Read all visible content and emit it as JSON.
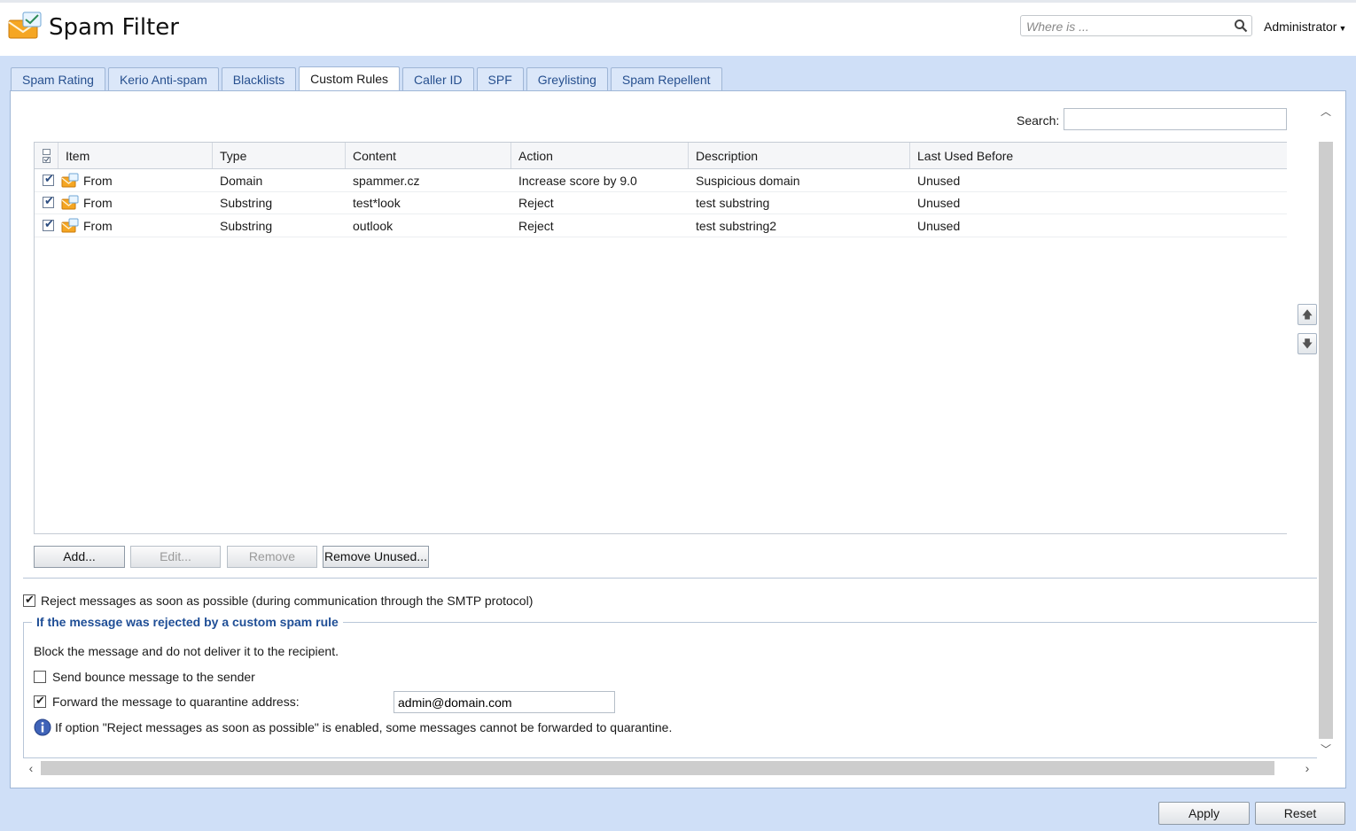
{
  "app": {
    "title": "Spam Filter",
    "search_placeholder": "Where is ...",
    "user_menu": "Administrator"
  },
  "tabs": [
    {
      "label": "Spam Rating",
      "active": false
    },
    {
      "label": "Kerio Anti-spam",
      "active": false
    },
    {
      "label": "Blacklists",
      "active": false
    },
    {
      "label": "Custom Rules",
      "active": true
    },
    {
      "label": "Caller ID",
      "active": false
    },
    {
      "label": "SPF",
      "active": false
    },
    {
      "label": "Greylisting",
      "active": false
    },
    {
      "label": "Spam Repellent",
      "active": false
    }
  ],
  "grid": {
    "search_label": "Search:",
    "search_value": "",
    "columns": [
      "Item",
      "Type",
      "Content",
      "Action",
      "Description",
      "Last Used Before"
    ],
    "rows": [
      {
        "checked": true,
        "item": "From",
        "type": "Domain",
        "content": "spammer.cz",
        "action": "Increase score by 9.0",
        "description": "Suspicious domain",
        "last_used": "Unused"
      },
      {
        "checked": true,
        "item": "From",
        "type": "Substring",
        "content": "test*look",
        "action": "Reject",
        "description": "test substring",
        "last_used": "Unused"
      },
      {
        "checked": true,
        "item": "From",
        "type": "Substring",
        "content": "outlook",
        "action": "Reject",
        "description": "test substring2",
        "last_used": "Unused"
      }
    ]
  },
  "buttons": {
    "add": "Add...",
    "edit": "Edit...",
    "remove": "Remove",
    "remove_unused": "Remove Unused..."
  },
  "options": {
    "reject_asap": {
      "label": "Reject messages as soon as possible (during communication through the SMTP protocol)",
      "checked": true
    },
    "group_title": "If the message was rejected by a custom spam rule",
    "block_text": "Block the message and do not deliver it to the recipient.",
    "send_bounce": {
      "label": "Send bounce message to the sender",
      "checked": false
    },
    "forward_quarantine": {
      "label": "Forward the message to quarantine address:",
      "checked": true,
      "value": "admin@domain.com"
    },
    "info_text": "If option \"Reject messages as soon as possible\" is enabled, some messages cannot be forwarded to quarantine."
  },
  "footer": {
    "apply": "Apply",
    "reset": "Reset"
  },
  "colors": {
    "accent": "#27508f",
    "background": "#cfdff7",
    "legend": "#1f4e96"
  }
}
